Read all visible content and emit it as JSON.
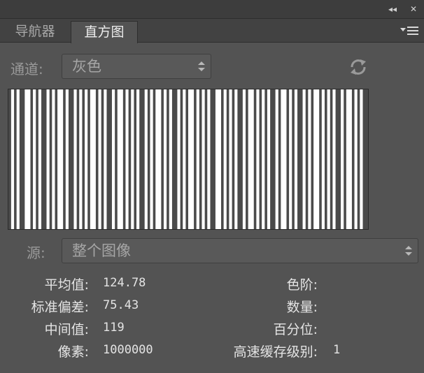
{
  "window": {
    "collapse_glyph": "◂◂",
    "close_glyph": "✕"
  },
  "tabs": [
    {
      "label": "导航器",
      "active": false
    },
    {
      "label": "直方图",
      "active": true
    }
  ],
  "channel": {
    "label": "通道:",
    "value": "灰色"
  },
  "source": {
    "label": "源:",
    "value": "整个图像"
  },
  "histogram": {
    "bars": [
      0,
      1,
      0,
      1,
      0,
      0,
      1,
      1,
      0,
      1,
      0,
      1,
      0,
      0,
      1,
      0,
      1,
      0,
      1,
      1,
      0,
      1,
      0,
      0,
      1,
      0,
      1,
      0,
      1,
      0,
      1,
      1,
      0,
      1,
      0,
      1,
      0,
      0,
      1,
      0,
      1,
      1,
      0,
      1,
      0,
      1,
      0,
      1,
      0,
      0,
      1,
      0,
      1,
      0,
      1,
      1,
      0,
      1,
      0,
      1,
      0,
      0,
      1,
      0,
      1,
      0,
      1,
      1,
      0,
      1,
      0,
      1,
      0,
      1,
      0,
      0,
      1,
      1,
      0,
      1,
      0,
      1,
      0,
      1,
      0,
      0,
      1,
      0,
      1,
      1,
      0,
      1,
      0,
      1,
      0,
      1,
      0,
      0,
      1,
      0,
      1,
      1,
      0,
      1,
      0,
      1,
      0,
      0,
      1,
      0,
      1,
      0,
      1,
      1,
      0,
      1,
      0,
      1,
      0,
      1,
      0,
      0,
      1,
      0,
      1,
      1,
      0,
      1,
      0,
      1,
      0,
      0
    ]
  },
  "stats": {
    "mean_label": "平均值:",
    "mean_value": "124.78",
    "std_label": "标准偏差:",
    "std_value": "75.43",
    "median_label": "中间值:",
    "median_value": "119",
    "pixels_label": "像素:",
    "pixels_value": "1000000",
    "level_label": "色阶:",
    "level_value": "",
    "count_label": "数量:",
    "count_value": "",
    "percentile_label": "百分位:",
    "percentile_value": "",
    "cache_label": "高速缓存级别:",
    "cache_value": "1"
  },
  "colors": {
    "panel_bg": "#535353",
    "histogram_bar": "#ffffff",
    "histogram_gap": "#4a4a4a"
  }
}
